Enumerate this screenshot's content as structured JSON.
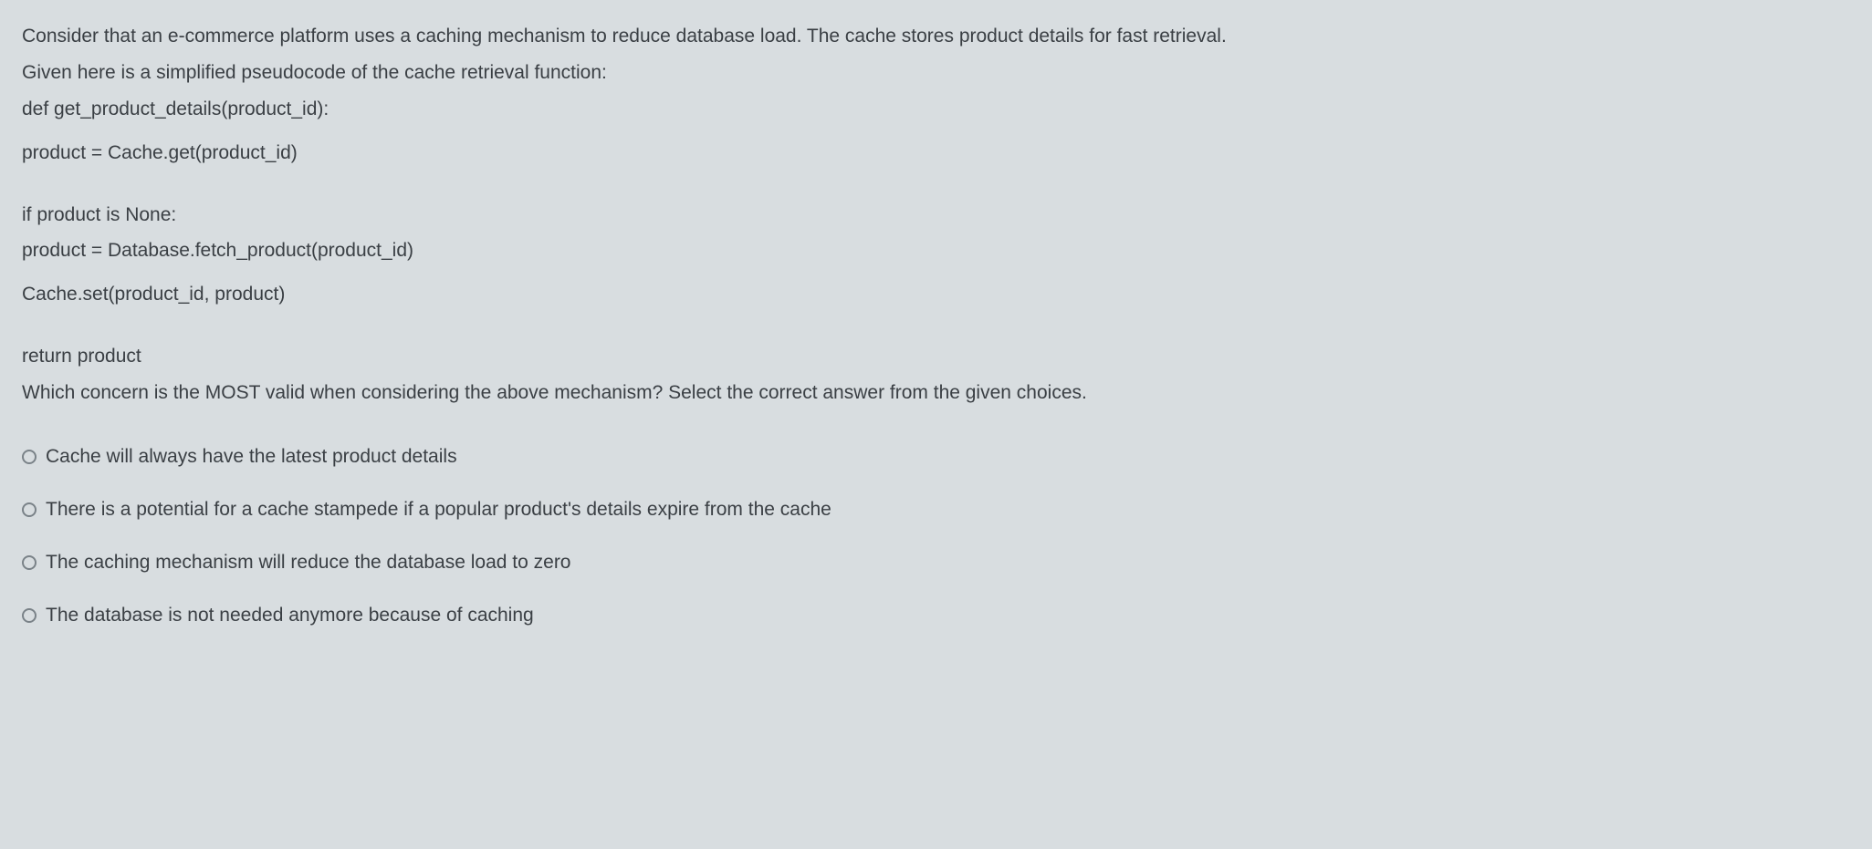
{
  "question": {
    "intro1": "Consider that an e-commerce platform uses a caching mechanism to reduce database load. The cache stores product details for fast retrieval.",
    "intro2": "Given here is a simplified pseudocode of the cache retrieval function:",
    "code1": "def get_product_details(product_id):",
    "code2": "product = Cache.get(product_id)",
    "code3": "if product is None:",
    "code4": "product = Database.fetch_product(product_id)",
    "code5": "Cache.set(product_id, product)",
    "code6": "return product",
    "prompt": "Which concern is the MOST valid when considering the above mechanism? Select the correct answer from the given choices."
  },
  "options": {
    "a": "Cache will always have the latest product details",
    "b": "There is a potential for a cache stampede if a popular product's details expire from the cache",
    "c": "The caching mechanism will reduce the database load to zero",
    "d": "The database is not needed anymore because of caching"
  }
}
